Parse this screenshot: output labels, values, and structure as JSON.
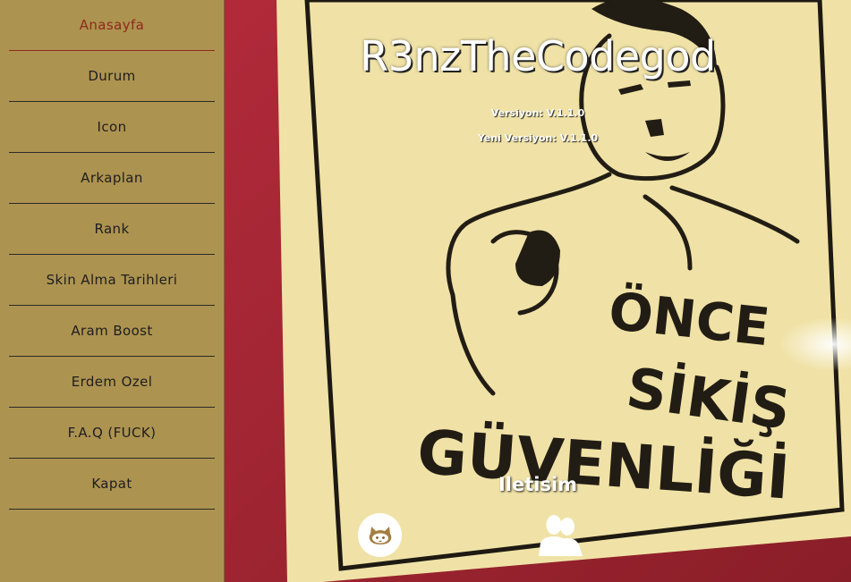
{
  "sidebar": {
    "items": [
      {
        "label": "Anasayfa",
        "active": true
      },
      {
        "label": "Durum"
      },
      {
        "label": "Icon"
      },
      {
        "label": "Arkaplan"
      },
      {
        "label": "Rank"
      },
      {
        "label": "Skin Alma Tarihleri"
      },
      {
        "label": "Aram Boost"
      },
      {
        "label": "Erdem Ozel"
      },
      {
        "label": "F.A.Q (FUCK)"
      },
      {
        "label": "Kapat"
      }
    ]
  },
  "main": {
    "title": "R3nzTheCodegod",
    "version": "Versiyon: V.1.1.0",
    "new_version": "Yeni Versiyon: V.1.1.0",
    "contact_title": "Iletisim",
    "background": {
      "sign_lines": [
        "ÖNCE",
        "SİKİŞ",
        "GÜVENLİĞİ"
      ]
    },
    "icons": [
      "github-icon",
      "users-icon"
    ]
  },
  "colors": {
    "sidebar_bg": "#ad9350",
    "active_text": "#8e2a1c",
    "sign_bg": "#f0e2a6",
    "wall_red": "#9c2432"
  }
}
